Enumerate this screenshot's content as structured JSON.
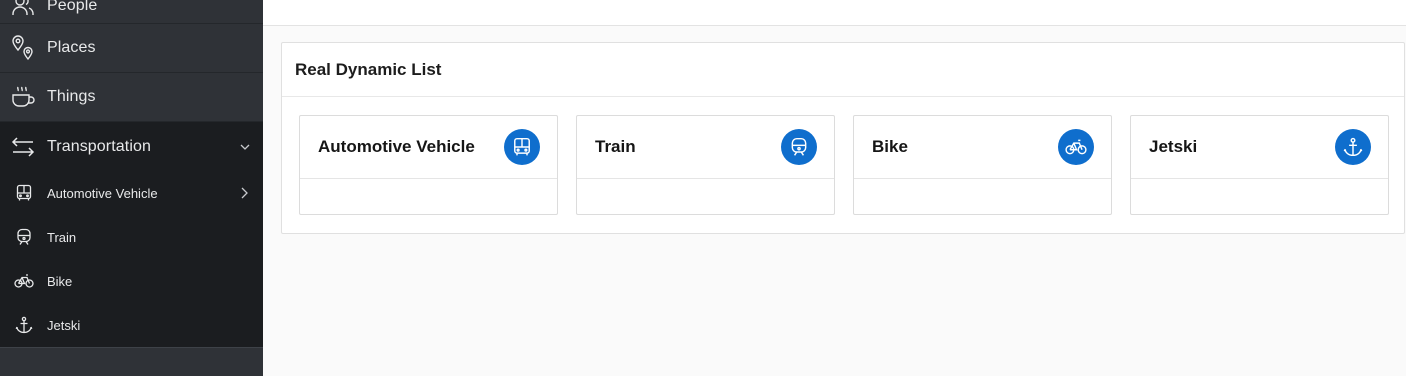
{
  "sidebar": {
    "items": [
      {
        "label": "People",
        "icon": "people-icon"
      },
      {
        "label": "Places",
        "icon": "map-pin-icon"
      },
      {
        "label": "Things",
        "icon": "coffee-cup-icon"
      },
      {
        "label": "Transportation",
        "icon": "arrows-left-right-icon"
      }
    ],
    "sub_items": [
      {
        "label": "Automotive Vehicle",
        "icon": "bus-icon"
      },
      {
        "label": "Train",
        "icon": "train-icon"
      },
      {
        "label": "Bike",
        "icon": "bike-icon"
      },
      {
        "label": "Jetski",
        "icon": "anchor-icon"
      }
    ]
  },
  "main": {
    "panel_title": "Real Dynamic List",
    "cards": [
      {
        "title": "Automotive Vehicle",
        "icon": "bus-icon"
      },
      {
        "title": "Train",
        "icon": "train-icon"
      },
      {
        "title": "Bike",
        "icon": "bike-icon"
      },
      {
        "title": "Jetski",
        "icon": "anchor-icon"
      }
    ]
  },
  "colors": {
    "sidebar_bg": "#2f3237",
    "sidebar_active_bg": "#1b1d20",
    "accent": "#0f6ecd"
  }
}
